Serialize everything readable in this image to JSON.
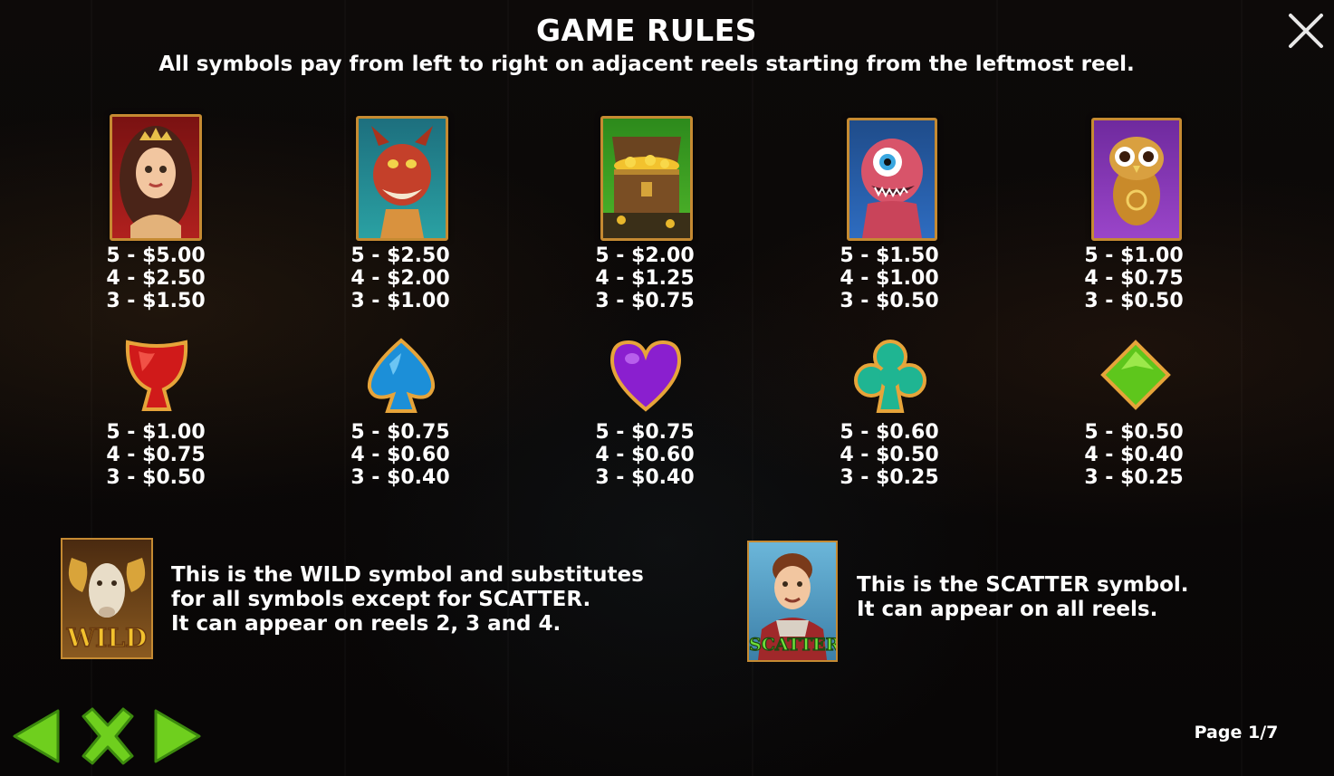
{
  "title": "GAME RULES",
  "subtitle": "All symbols pay from left to right on adjacent reels starting from the leftmost reel.",
  "close_icon": "close-icon",
  "high_symbols": [
    {
      "name": "princess",
      "icon": "princess-symbol",
      "pays": [
        "5 - $5.00",
        "4 - $2.50",
        "3 - $1.50"
      ]
    },
    {
      "name": "dragon",
      "icon": "dragon-symbol",
      "pays": [
        "5 - $2.50",
        "4 - $2.00",
        "3 - $1.00"
      ]
    },
    {
      "name": "treasure",
      "icon": "treasure-chest-symbol",
      "pays": [
        "5 - $2.00",
        "4 - $1.25",
        "3 - $0.75"
      ]
    },
    {
      "name": "monster",
      "icon": "one-eyed-monster-symbol",
      "pays": [
        "5 - $1.50",
        "4 - $1.00",
        "3 - $0.50"
      ]
    },
    {
      "name": "owl",
      "icon": "owl-symbol",
      "pays": [
        "5 - $1.00",
        "4 - $0.75",
        "3 - $0.50"
      ]
    }
  ],
  "low_symbols": [
    {
      "name": "heart-red",
      "icon": "red-cup-suit-symbol",
      "pays": [
        "5 - $1.00",
        "4 - $0.75",
        "3 - $0.50"
      ]
    },
    {
      "name": "spade",
      "icon": "blue-spade-symbol",
      "pays": [
        "5 - $0.75",
        "4 - $0.60",
        "3 - $0.40"
      ]
    },
    {
      "name": "heart",
      "icon": "purple-heart-symbol",
      "pays": [
        "5 - $0.75",
        "4 - $0.60",
        "3 - $0.40"
      ]
    },
    {
      "name": "club",
      "icon": "green-club-symbol",
      "pays": [
        "5 - $0.60",
        "4 - $0.50",
        "3 - $0.25"
      ]
    },
    {
      "name": "diamond",
      "icon": "green-diamond-symbol",
      "pays": [
        "5 - $0.50",
        "4 - $0.40",
        "3 - $0.25"
      ]
    }
  ],
  "wild": {
    "label": "WILD",
    "lines": [
      "This is the WILD symbol and substitutes",
      "for all symbols except for SCATTER.",
      "It can appear on reels 2, 3 and 4."
    ]
  },
  "scatter": {
    "label": "SCATTER",
    "lines": [
      "This is the SCATTER symbol.",
      "It can appear on all reels."
    ]
  },
  "nav": {
    "prev_icon": "arrow-left-icon",
    "close_icon": "close-x-icon",
    "next_icon": "arrow-right-icon"
  },
  "page": "Page 1/7",
  "colors": {
    "frame": "#c58a32",
    "nav_green": "#6fcf1e",
    "text": "#ffffff"
  }
}
